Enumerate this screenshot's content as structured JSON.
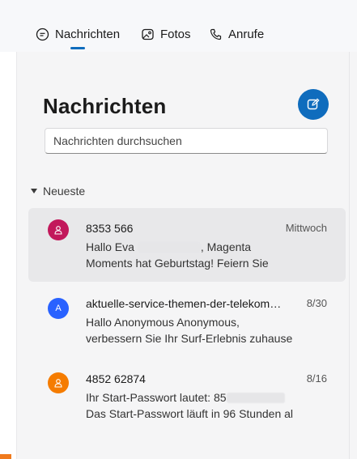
{
  "tabs": [
    {
      "label": "Nachrichten",
      "icon": "chat-icon",
      "active": true
    },
    {
      "label": "Fotos",
      "icon": "photo-icon",
      "active": false
    },
    {
      "label": "Anrufe",
      "icon": "phone-icon",
      "active": false
    }
  ],
  "header": {
    "title": "Nachrichten",
    "compose_icon": "compose-icon"
  },
  "search": {
    "placeholder": "Nachrichten durchsuchen"
  },
  "section_label": "Neueste",
  "conversations": [
    {
      "sender": "8353 566",
      "date": "Mittwoch",
      "preview_line1_a": "Hallo Eva",
      "preview_line1_b": ", Magenta",
      "preview_line2": "Moments hat Geburtstag! Feiern Sie",
      "avatar_color": "#c2185b",
      "avatar_icon": "person-icon",
      "selected": true
    },
    {
      "sender": "aktuelle-service-themen-der-telekom…",
      "date": "8/30",
      "avatar_letter": "A",
      "preview_line1": "Hallo Anonymous Anonymous,",
      "preview_line2": "verbessern Sie Ihr Surf-Erlebnis zuhause",
      "avatar_color": "#2962ff",
      "selected": false
    },
    {
      "sender": "4852 62874",
      "date": "8/16",
      "preview_line1_a": "Ihr Start-Passwort lautet: 85",
      "preview_line2": "Das Start-Passwort läuft in 96 Stunden al",
      "avatar_color": "#f57c00",
      "avatar_icon": "person-icon",
      "selected": false
    }
  ],
  "colors": {
    "accent": "#0f6cbd"
  }
}
